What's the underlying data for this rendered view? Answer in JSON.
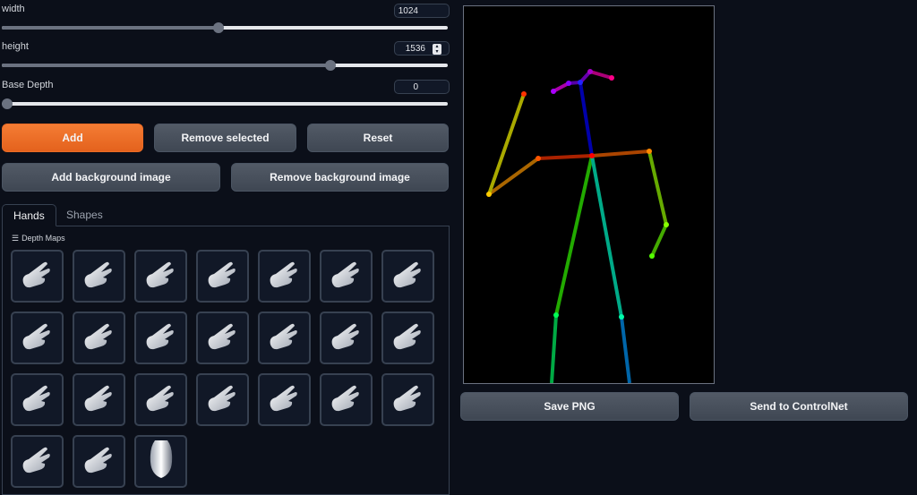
{
  "sliders": [
    {
      "label": "width",
      "value": "1024",
      "fraction": 0.484
    },
    {
      "label": "height",
      "value": "1536",
      "fraction": 0.738
    },
    {
      "label": "Base Depth",
      "value": "0",
      "fraction": 0.0
    }
  ],
  "buttons": {
    "add": "Add",
    "remove_selected": "Remove selected",
    "reset": "Reset",
    "add_bg": "Add background image",
    "remove_bg": "Remove background image",
    "save_png": "Save PNG",
    "send_controlnet": "Send to ControlNet"
  },
  "tabs": [
    {
      "label": "Hands",
      "active": true
    },
    {
      "label": "Shapes",
      "active": false
    }
  ],
  "gallery": {
    "label": "Depth Maps",
    "items": [
      "hand-depth-map-icon",
      "hand-depth-map-icon",
      "hand-depth-map-icon",
      "hand-depth-map-icon",
      "hand-depth-map-icon",
      "hand-depth-map-icon",
      "hand-depth-map-icon",
      "hand-depth-map-icon",
      "hand-depth-map-icon",
      "hand-depth-map-icon",
      "hand-depth-map-icon",
      "hand-depth-map-icon",
      "hand-depth-map-icon",
      "hand-depth-map-icon",
      "hand-depth-map-icon",
      "hand-depth-map-icon",
      "hand-depth-map-icon",
      "hand-depth-map-icon",
      "hand-depth-map-icon",
      "hand-depth-map-icon",
      "hand-depth-map-icon",
      "hand-depth-map-icon",
      "hand-depth-map-icon",
      "shape-depth-map-icon"
    ]
  },
  "colors": {
    "accent": "#f0712a",
    "background": "#0b0f19",
    "button": "#4b5563"
  }
}
